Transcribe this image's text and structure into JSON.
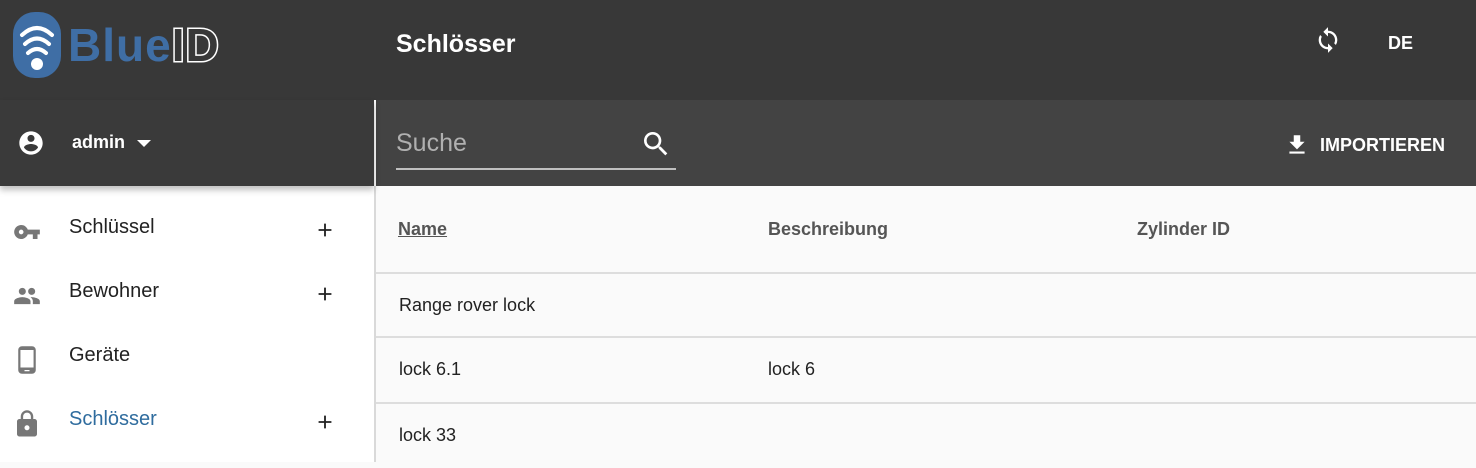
{
  "app": {
    "logo_text_blue": "Blue",
    "logo_text_id": "ID",
    "page_title": "Schlösser",
    "language": "DE",
    "accent_color": "#2f6c9e",
    "header_color": "#383838"
  },
  "user": {
    "name": "admin"
  },
  "sidebar": {
    "items": [
      {
        "label": "Schlüssel",
        "icon": "key-icon",
        "has_add": true,
        "active": false
      },
      {
        "label": "Bewohner",
        "icon": "people-icon",
        "has_add": true,
        "active": false
      },
      {
        "label": "Geräte",
        "icon": "phone-icon",
        "has_add": false,
        "active": false
      },
      {
        "label": "Schlösser",
        "icon": "lock-icon",
        "has_add": true,
        "active": true
      }
    ]
  },
  "toolbar": {
    "search_placeholder": "Suche",
    "import_label": "IMPORTIEREN"
  },
  "table": {
    "columns": [
      "Name",
      "Beschreibung",
      "Zylinder ID"
    ],
    "rows": [
      [
        "Range rover lock",
        "",
        ""
      ],
      [
        "lock 6.1",
        "lock 6",
        ""
      ],
      [
        "lock 33",
        "",
        ""
      ]
    ]
  }
}
